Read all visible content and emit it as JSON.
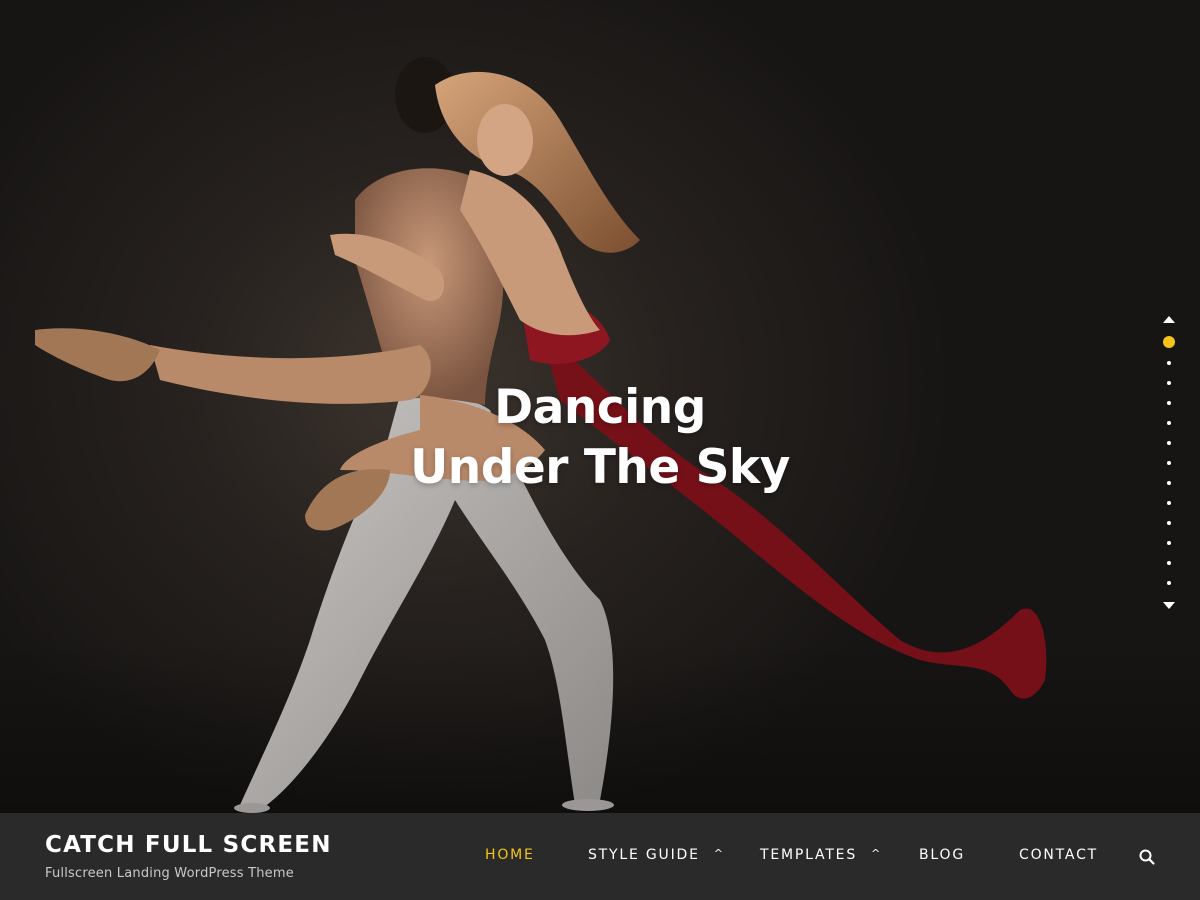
{
  "hero": {
    "title_line1": "Dancing",
    "title_line2": "Under The Sky",
    "image_icon": "dancing-couple-photo"
  },
  "slide_nav": {
    "slide_count": 13,
    "active_index": 0,
    "up_icon": "triangle-up-icon",
    "down_icon": "triangle-down-icon",
    "active_color": "#f5c31a",
    "dot_color": "#ffffff"
  },
  "header": {
    "site_title": "CATCH FULL SCREEN",
    "tagline": "Fullscreen Landing WordPress Theme",
    "background": "#2a2a2a"
  },
  "nav": {
    "active_color": "#f5c31a",
    "items": [
      {
        "label": "HOME",
        "active": true,
        "has_submenu": false
      },
      {
        "label": "STYLE GUIDE",
        "active": false,
        "has_submenu": true
      },
      {
        "label": "TEMPLATES",
        "active": false,
        "has_submenu": true
      },
      {
        "label": "BLOG",
        "active": false,
        "has_submenu": false
      },
      {
        "label": "CONTACT",
        "active": false,
        "has_submenu": false
      }
    ],
    "search_icon": "search-icon"
  }
}
